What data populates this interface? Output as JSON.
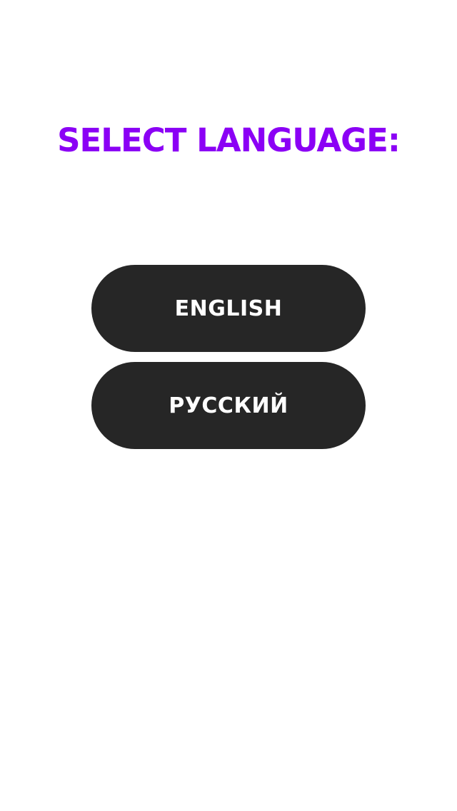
{
  "header": {
    "title": "SELECT LANGUAGE:"
  },
  "languages": [
    {
      "label": "ENGLISH"
    },
    {
      "label": "РУССКИЙ"
    }
  ],
  "colors": {
    "title": "#8b00f5",
    "button_bg": "#262626",
    "button_text": "#ffffff",
    "background": "#ffffff"
  }
}
